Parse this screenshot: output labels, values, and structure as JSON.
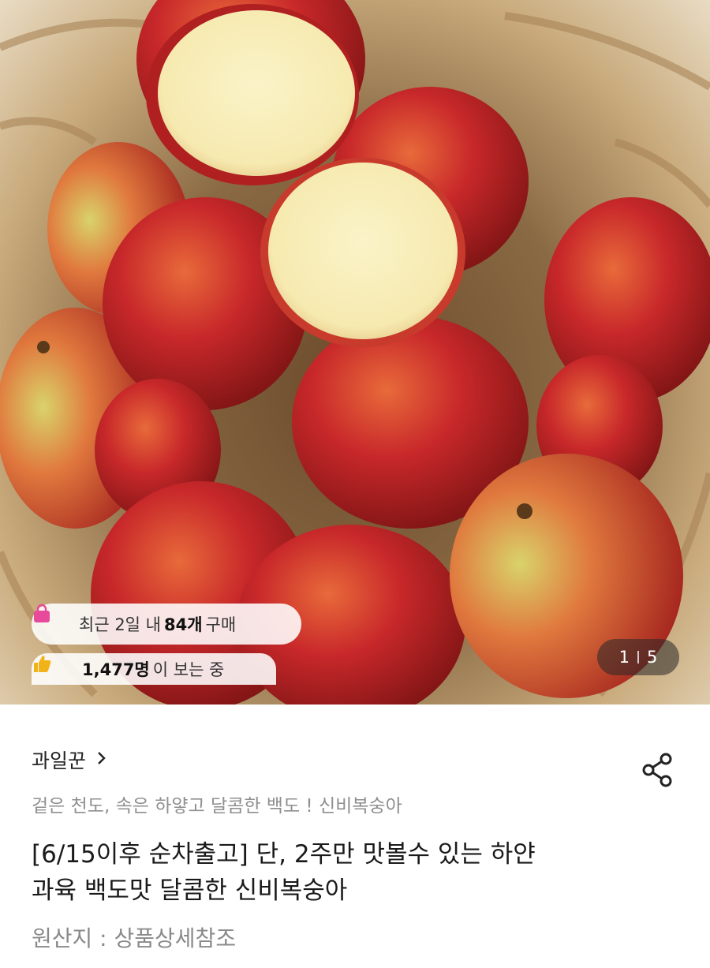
{
  "badges": {
    "recent_prefix": "최근 2일 내 ",
    "recent_count": "84개",
    "recent_suffix": " 구매",
    "viewing_count": "1,477명",
    "viewing_suffix": "이 보는 중"
  },
  "gallery": {
    "current": "1",
    "total": "5"
  },
  "product": {
    "store_name": "과일꾼",
    "subtitle": "겉은 천도, 속은 하얗고 달콤한 백도 ! 신비복숭아",
    "title_line1": "[6/15이후 순차출고] 단, 2주만  맛볼수 있는 하얀",
    "title_line2": "과육 백도맛 달콤한 신비복숭아",
    "origin": "원산지 : 상품상세참조"
  },
  "icons": {
    "bag": "shopping-bag-icon",
    "thumb": "thumbs-up-icon",
    "share": "share-icon",
    "chevron": "chevron-right-icon"
  },
  "colors": {
    "bag_pink": "#e84a9b",
    "thumb_yellow": "#f2b318"
  }
}
